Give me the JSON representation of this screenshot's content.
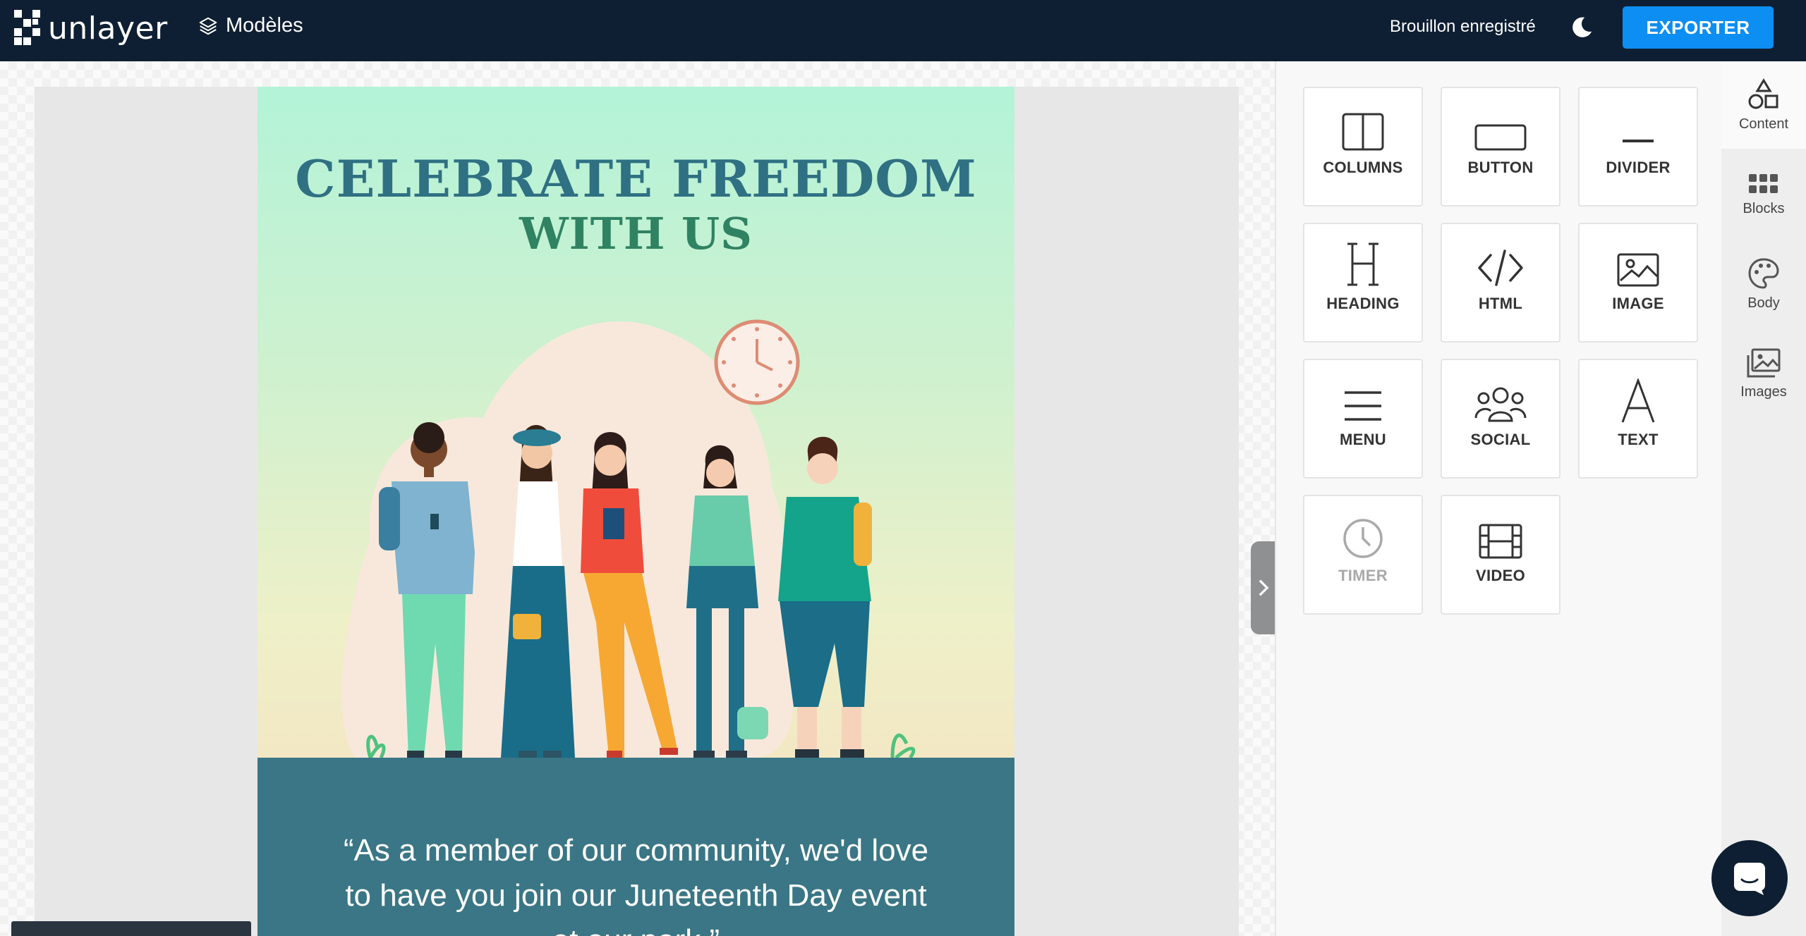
{
  "topbar": {
    "logo_text": "unlayer",
    "templates_label": "Modèles",
    "draft_status": "Brouillon enregistré",
    "export_label": "EXPORTER",
    "theme_icon": "moon-icon",
    "bg_color": "#0f1f33",
    "accent_color": "#0d8ef2"
  },
  "email": {
    "title_line1": "CELEBRATE FREEDOM",
    "title_line2": "WITH US",
    "quote_line1": "“As a member of our community, we'd love",
    "quote_line2": "to have you join our Juneteenth Day event",
    "quote_line3": "at our park.”",
    "quote_bg": "#3a7685"
  },
  "content_tiles": [
    {
      "label": "COLUMNS",
      "icon": "columns-icon",
      "disabled": false
    },
    {
      "label": "BUTTON",
      "icon": "button-icon",
      "disabled": false
    },
    {
      "label": "DIVIDER",
      "icon": "divider-icon",
      "disabled": false
    },
    {
      "label": "HEADING",
      "icon": "heading-icon",
      "disabled": false
    },
    {
      "label": "HTML",
      "icon": "code-icon",
      "disabled": false
    },
    {
      "label": "IMAGE",
      "icon": "image-icon",
      "disabled": false
    },
    {
      "label": "MENU",
      "icon": "menu-icon",
      "disabled": false
    },
    {
      "label": "SOCIAL",
      "icon": "social-icon",
      "disabled": false
    },
    {
      "label": "TEXT",
      "icon": "text-icon",
      "disabled": false
    },
    {
      "label": "TIMER",
      "icon": "clock-icon",
      "disabled": true
    },
    {
      "label": "VIDEO",
      "icon": "film-icon",
      "disabled": false
    }
  ],
  "sidebar": {
    "items": [
      {
        "label": "Content",
        "icon": "shapes-icon",
        "active": true
      },
      {
        "label": "Blocks",
        "icon": "grid-icon",
        "active": false
      },
      {
        "label": "Body",
        "icon": "palette-icon",
        "active": false
      },
      {
        "label": "Images",
        "icon": "images-icon",
        "active": false
      }
    ]
  }
}
